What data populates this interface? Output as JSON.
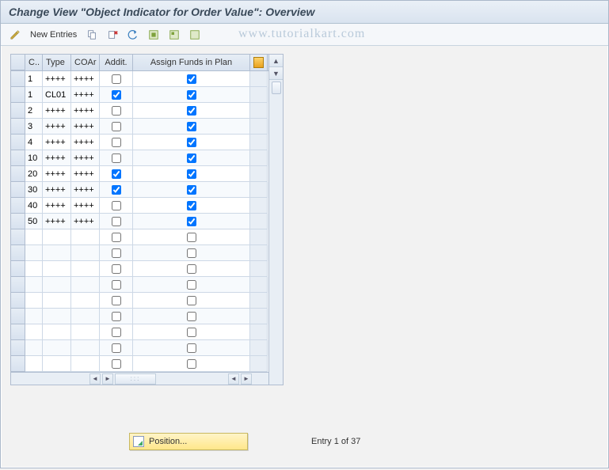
{
  "title": "Change View \"Object Indicator for Order Value\": Overview",
  "watermark": "www.tutorialkart.com",
  "toolbar": {
    "new_entries_label": "New Entries"
  },
  "grid": {
    "headers": {
      "c": "C..",
      "type": "Type",
      "coar": "COAr",
      "addit": "Addit.",
      "afp": "Assign Funds in Plan"
    },
    "rows": [
      {
        "c": "1",
        "type": "++++",
        "coar": "++++",
        "addit": false,
        "afp": true
      },
      {
        "c": "1",
        "type": "CL01",
        "coar": "++++",
        "addit": true,
        "afp": true
      },
      {
        "c": "2",
        "type": "++++",
        "coar": "++++",
        "addit": false,
        "afp": true
      },
      {
        "c": "3",
        "type": "++++",
        "coar": "++++",
        "addit": false,
        "afp": true
      },
      {
        "c": "4",
        "type": "++++",
        "coar": "++++",
        "addit": false,
        "afp": true
      },
      {
        "c": "10",
        "type": "++++",
        "coar": "++++",
        "addit": false,
        "afp": true
      },
      {
        "c": "20",
        "type": "++++",
        "coar": "++++",
        "addit": true,
        "afp": true
      },
      {
        "c": "30",
        "type": "++++",
        "coar": "++++",
        "addit": true,
        "afp": true
      },
      {
        "c": "40",
        "type": "++++",
        "coar": "++++",
        "addit": false,
        "afp": true
      },
      {
        "c": "50",
        "type": "++++",
        "coar": "++++",
        "addit": false,
        "afp": true
      },
      {
        "c": "",
        "type": "",
        "coar": "",
        "addit": false,
        "afp": false
      },
      {
        "c": "",
        "type": "",
        "coar": "",
        "addit": false,
        "afp": false
      },
      {
        "c": "",
        "type": "",
        "coar": "",
        "addit": false,
        "afp": false
      },
      {
        "c": "",
        "type": "",
        "coar": "",
        "addit": false,
        "afp": false
      },
      {
        "c": "",
        "type": "",
        "coar": "",
        "addit": false,
        "afp": false
      },
      {
        "c": "",
        "type": "",
        "coar": "",
        "addit": false,
        "afp": false
      },
      {
        "c": "",
        "type": "",
        "coar": "",
        "addit": false,
        "afp": false
      },
      {
        "c": "",
        "type": "",
        "coar": "",
        "addit": false,
        "afp": false
      },
      {
        "c": "",
        "type": "",
        "coar": "",
        "addit": false,
        "afp": false
      }
    ]
  },
  "footer": {
    "position_label": "Position...",
    "entry_text": "Entry 1 of 37"
  }
}
